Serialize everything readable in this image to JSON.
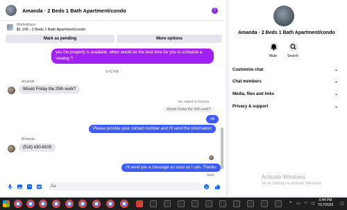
{
  "header": {
    "title": "Amanda · 2 Beds 1 Bath Apartment/condo",
    "info_icon": "i"
  },
  "marketplace": {
    "label": "Marketplace",
    "listing": "$1,100 - 2 Beds 1 Bath Apartment/condo"
  },
  "actions": {
    "pending": "Mark as pending",
    "more": "More options"
  },
  "messages": {
    "m1": "yes the property is available. when would be the best time for you to schedule a",
    "m1b": "viewing ?",
    "ts1": "6:41 PM",
    "name1": "Amanda",
    "in1": "Would Friday the 25th work?",
    "reply_note": "You replied to Amanda",
    "reply_quote": "Would Friday the 25th work?",
    "ok": "ok",
    "m2": "Please provide your contact number and I'll send the information",
    "name2": "Amanda",
    "in2": "(516) 430-8100",
    "m3": "I'll send you a message as soon as I can. Thanks",
    "sent": "Sent"
  },
  "composer": {
    "placeholder": "Aa"
  },
  "side": {
    "title": "Amanda · 2 Beds 1 Bath Apartment/condo",
    "mute": "Mute",
    "search": "Search",
    "menu": [
      "Customize chat",
      "Chat members",
      "Media, files and links",
      "Privacy & support"
    ]
  },
  "watermark": {
    "title": "Activate Windows",
    "sub": "Go to Settings to activate Windows."
  },
  "taskbar": {
    "time": "6:44 PM",
    "date": "7/17/2025"
  },
  "colors": {
    "accent": "#3d5afe",
    "purple": "#a121f5",
    "taskbar": "#1f1f1f"
  }
}
